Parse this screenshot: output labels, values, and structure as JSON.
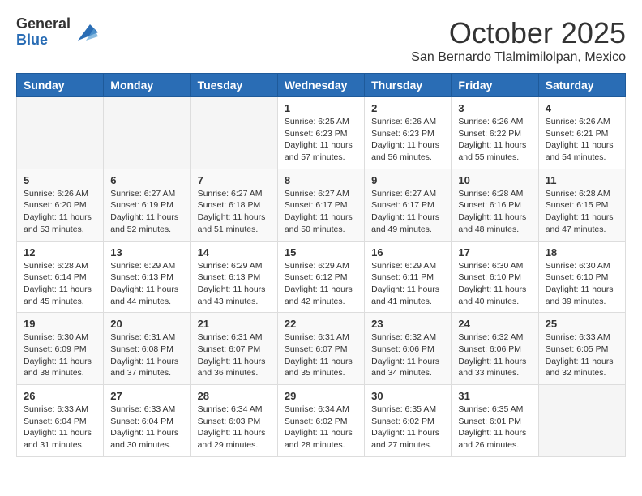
{
  "header": {
    "logo_general": "General",
    "logo_blue": "Blue",
    "month_title": "October 2025",
    "subtitle": "San Bernardo Tlalmimilolpan, Mexico"
  },
  "calendar": {
    "days_of_week": [
      "Sunday",
      "Monday",
      "Tuesday",
      "Wednesday",
      "Thursday",
      "Friday",
      "Saturday"
    ],
    "weeks": [
      [
        {
          "day": "",
          "info": ""
        },
        {
          "day": "",
          "info": ""
        },
        {
          "day": "",
          "info": ""
        },
        {
          "day": "1",
          "info": "Sunrise: 6:25 AM\nSunset: 6:23 PM\nDaylight: 11 hours and 57 minutes."
        },
        {
          "day": "2",
          "info": "Sunrise: 6:26 AM\nSunset: 6:23 PM\nDaylight: 11 hours and 56 minutes."
        },
        {
          "day": "3",
          "info": "Sunrise: 6:26 AM\nSunset: 6:22 PM\nDaylight: 11 hours and 55 minutes."
        },
        {
          "day": "4",
          "info": "Sunrise: 6:26 AM\nSunset: 6:21 PM\nDaylight: 11 hours and 54 minutes."
        }
      ],
      [
        {
          "day": "5",
          "info": "Sunrise: 6:26 AM\nSunset: 6:20 PM\nDaylight: 11 hours and 53 minutes."
        },
        {
          "day": "6",
          "info": "Sunrise: 6:27 AM\nSunset: 6:19 PM\nDaylight: 11 hours and 52 minutes."
        },
        {
          "day": "7",
          "info": "Sunrise: 6:27 AM\nSunset: 6:18 PM\nDaylight: 11 hours and 51 minutes."
        },
        {
          "day": "8",
          "info": "Sunrise: 6:27 AM\nSunset: 6:17 PM\nDaylight: 11 hours and 50 minutes."
        },
        {
          "day": "9",
          "info": "Sunrise: 6:27 AM\nSunset: 6:17 PM\nDaylight: 11 hours and 49 minutes."
        },
        {
          "day": "10",
          "info": "Sunrise: 6:28 AM\nSunset: 6:16 PM\nDaylight: 11 hours and 48 minutes."
        },
        {
          "day": "11",
          "info": "Sunrise: 6:28 AM\nSunset: 6:15 PM\nDaylight: 11 hours and 47 minutes."
        }
      ],
      [
        {
          "day": "12",
          "info": "Sunrise: 6:28 AM\nSunset: 6:14 PM\nDaylight: 11 hours and 45 minutes."
        },
        {
          "day": "13",
          "info": "Sunrise: 6:29 AM\nSunset: 6:13 PM\nDaylight: 11 hours and 44 minutes."
        },
        {
          "day": "14",
          "info": "Sunrise: 6:29 AM\nSunset: 6:13 PM\nDaylight: 11 hours and 43 minutes."
        },
        {
          "day": "15",
          "info": "Sunrise: 6:29 AM\nSunset: 6:12 PM\nDaylight: 11 hours and 42 minutes."
        },
        {
          "day": "16",
          "info": "Sunrise: 6:29 AM\nSunset: 6:11 PM\nDaylight: 11 hours and 41 minutes."
        },
        {
          "day": "17",
          "info": "Sunrise: 6:30 AM\nSunset: 6:10 PM\nDaylight: 11 hours and 40 minutes."
        },
        {
          "day": "18",
          "info": "Sunrise: 6:30 AM\nSunset: 6:10 PM\nDaylight: 11 hours and 39 minutes."
        }
      ],
      [
        {
          "day": "19",
          "info": "Sunrise: 6:30 AM\nSunset: 6:09 PM\nDaylight: 11 hours and 38 minutes."
        },
        {
          "day": "20",
          "info": "Sunrise: 6:31 AM\nSunset: 6:08 PM\nDaylight: 11 hours and 37 minutes."
        },
        {
          "day": "21",
          "info": "Sunrise: 6:31 AM\nSunset: 6:07 PM\nDaylight: 11 hours and 36 minutes."
        },
        {
          "day": "22",
          "info": "Sunrise: 6:31 AM\nSunset: 6:07 PM\nDaylight: 11 hours and 35 minutes."
        },
        {
          "day": "23",
          "info": "Sunrise: 6:32 AM\nSunset: 6:06 PM\nDaylight: 11 hours and 34 minutes."
        },
        {
          "day": "24",
          "info": "Sunrise: 6:32 AM\nSunset: 6:06 PM\nDaylight: 11 hours and 33 minutes."
        },
        {
          "day": "25",
          "info": "Sunrise: 6:33 AM\nSunset: 6:05 PM\nDaylight: 11 hours and 32 minutes."
        }
      ],
      [
        {
          "day": "26",
          "info": "Sunrise: 6:33 AM\nSunset: 6:04 PM\nDaylight: 11 hours and 31 minutes."
        },
        {
          "day": "27",
          "info": "Sunrise: 6:33 AM\nSunset: 6:04 PM\nDaylight: 11 hours and 30 minutes."
        },
        {
          "day": "28",
          "info": "Sunrise: 6:34 AM\nSunset: 6:03 PM\nDaylight: 11 hours and 29 minutes."
        },
        {
          "day": "29",
          "info": "Sunrise: 6:34 AM\nSunset: 6:02 PM\nDaylight: 11 hours and 28 minutes."
        },
        {
          "day": "30",
          "info": "Sunrise: 6:35 AM\nSunset: 6:02 PM\nDaylight: 11 hours and 27 minutes."
        },
        {
          "day": "31",
          "info": "Sunrise: 6:35 AM\nSunset: 6:01 PM\nDaylight: 11 hours and 26 minutes."
        },
        {
          "day": "",
          "info": ""
        }
      ]
    ]
  }
}
